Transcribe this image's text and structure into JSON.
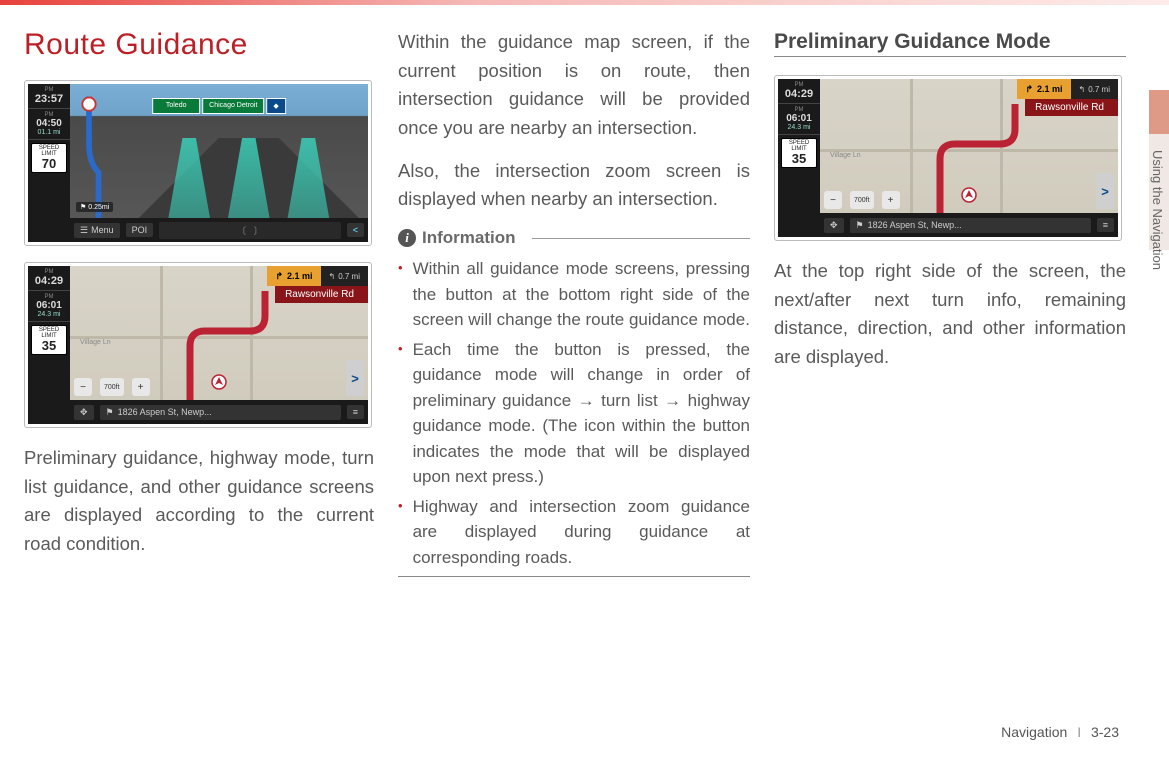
{
  "page": {
    "section_label": "Using the Navigation",
    "footer_chapter": "Navigation",
    "footer_page": "3-23"
  },
  "col1": {
    "title": "Route Guidance",
    "shot1": {
      "time": "23:57",
      "mph": "04:50",
      "eta_mi": "01.1 mi",
      "speed_label": "SPEED LIMIT",
      "speed": "70",
      "sign1": "Toledo",
      "sign2": "Chicago Detroit",
      "menu": "Menu",
      "poi": "POI",
      "dist_small": "0.25mi"
    },
    "shot2": {
      "time": "04:29",
      "mph": "06:01",
      "eta_mi": "24.3 mi",
      "speed_label": "SPEED LIMIT",
      "speed": "35",
      "turn_dist": "2.1 mi",
      "next_dist": "0.7 mi",
      "road": "Rawsonville Rd",
      "addr": "1826 Aspen St, Newp...",
      "scale": "700ft",
      "lane_label": "Village Ln"
    },
    "para": "Preliminary guidance, highway mode, turn list guidance, and other guidance screens are displayed according to the current road condition."
  },
  "col2": {
    "para1": "Within the guidance map screen, if the current position is on route, then intersection guidance will be provided once you are nearby an intersection.",
    "para2": "Also, the intersection zoom screen is displayed when nearby an intersection.",
    "info_title": "Information",
    "bullets": [
      "Within all guidance mode screens, pressing the button at the bottom right side of the screen will change the route guidance mode.",
      "Each time the button is pressed, the guidance mode will change in order of preliminary guidance → turn list → highway guidance mode. (The icon within the button indicates the mode that will be displayed upon next press.)",
      "Highway and intersection zoom guidance are displayed during guidance at corresponding roads."
    ]
  },
  "col3": {
    "subhead": "Preliminary Guidance Mode",
    "shot": {
      "time": "04:29",
      "mph": "06:01",
      "eta_mi": "24.3 mi",
      "speed_label": "SPEED LIMIT",
      "speed": "35",
      "turn_dist": "2.1 mi",
      "next_dist": "0.7 mi",
      "road": "Rawsonville Rd",
      "addr": "1826 Aspen St, Newp...",
      "scale": "700ft",
      "lane_label": "Village Ln"
    },
    "para": "At the top right side of the screen, the next/after next turn info, remaining distance, direction, and other information are displayed."
  }
}
